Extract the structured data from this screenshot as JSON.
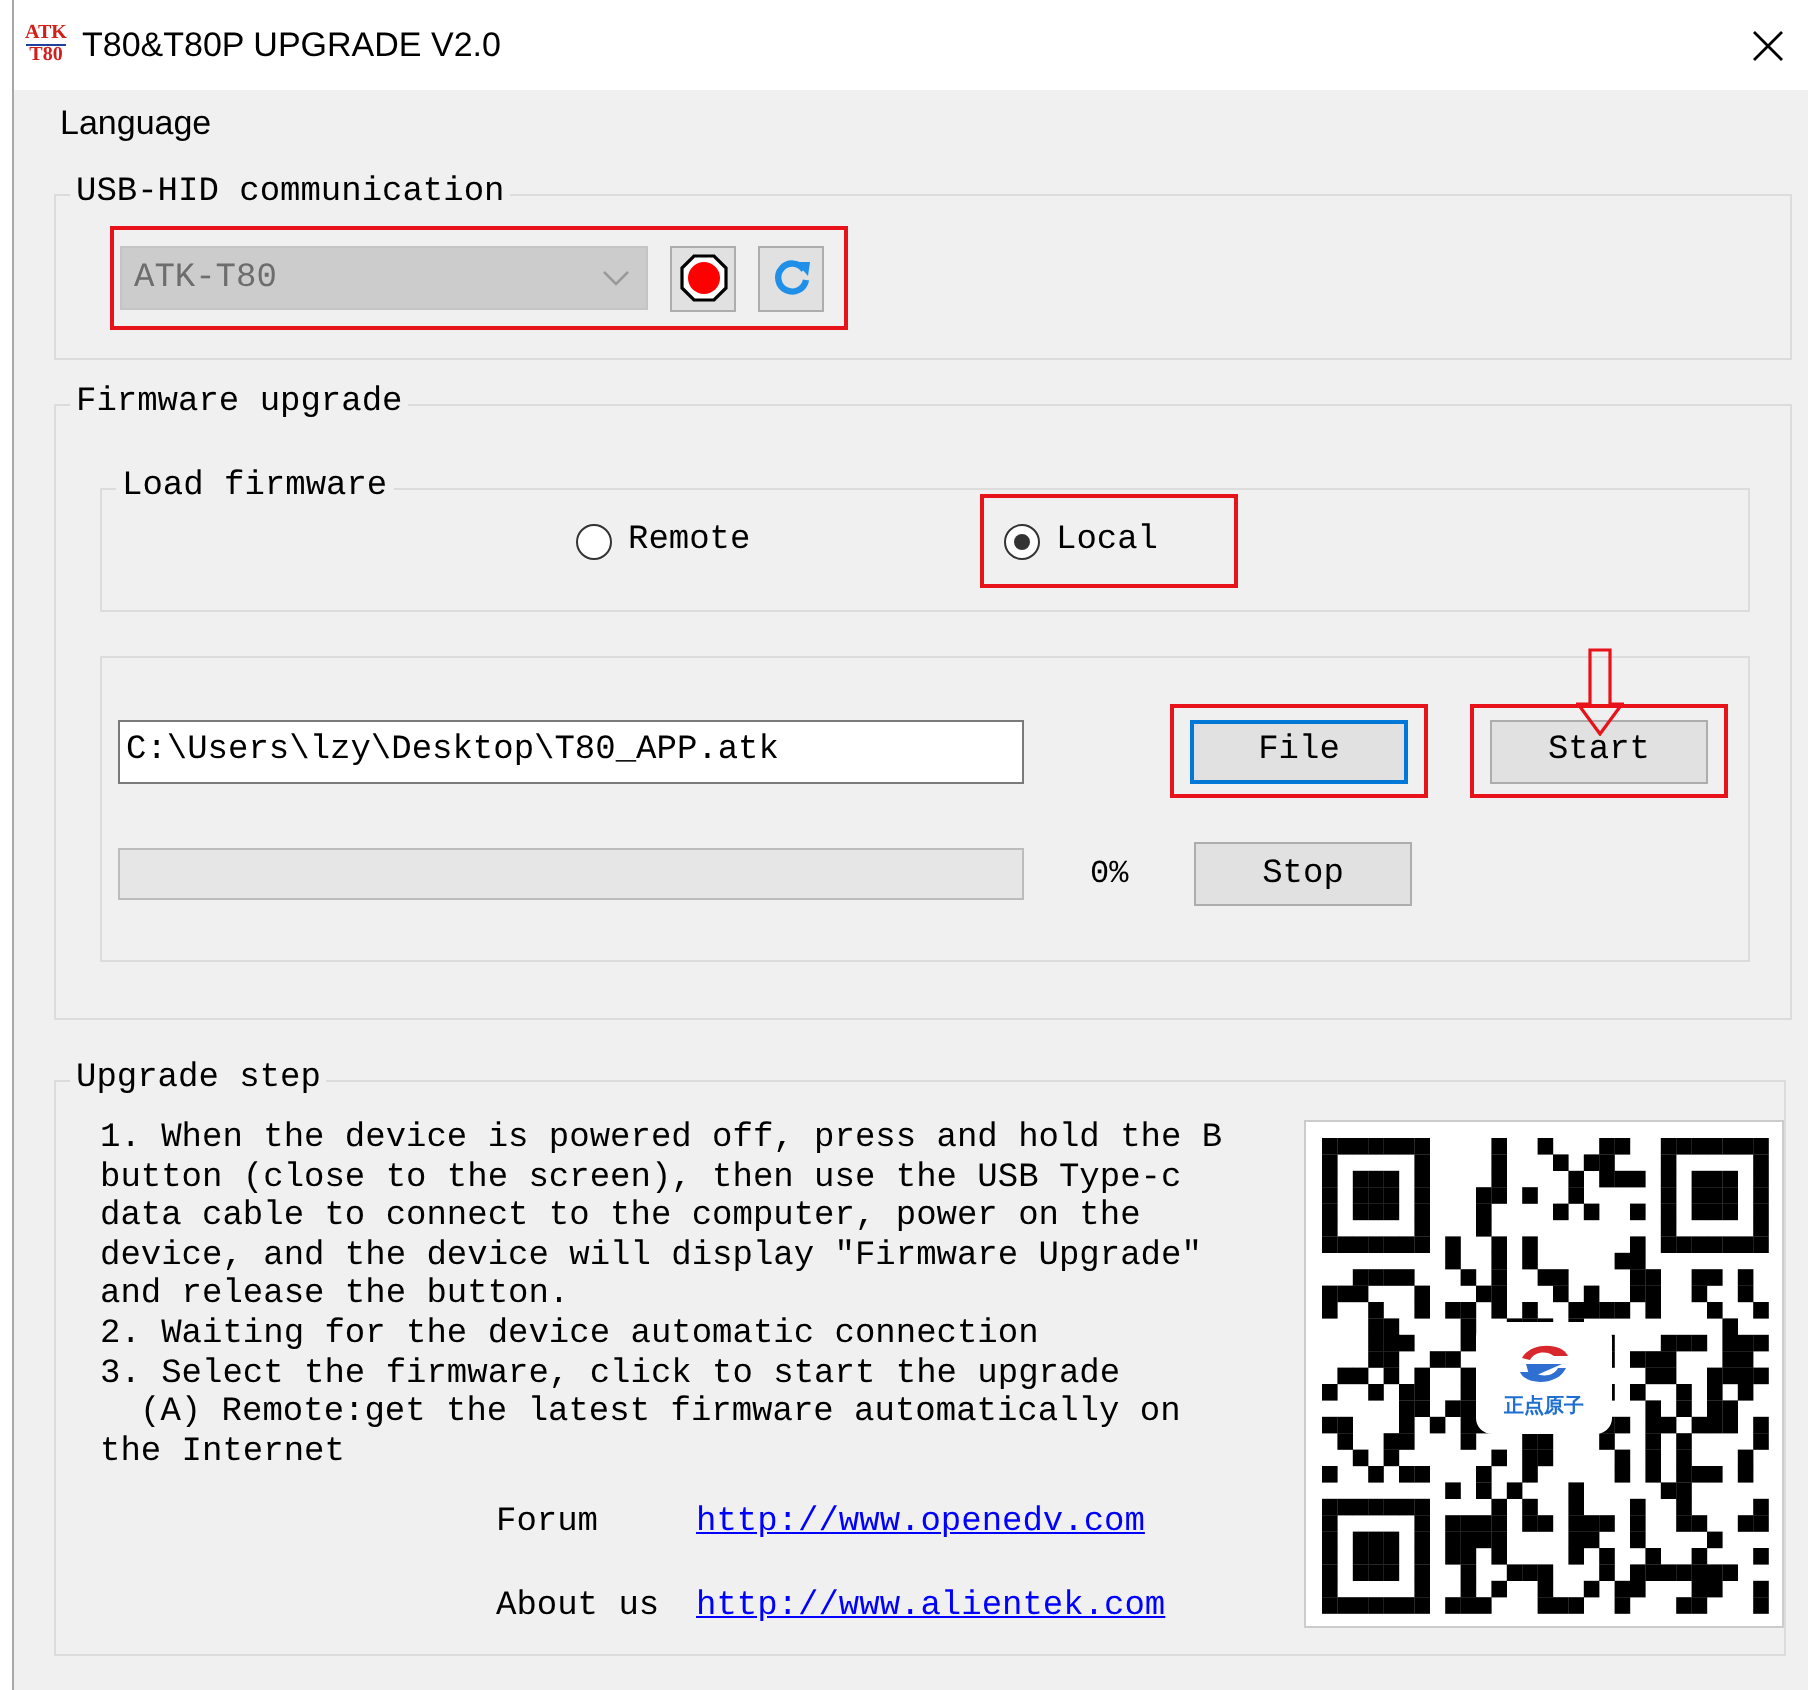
{
  "window": {
    "icon_top": "ATK",
    "icon_bottom": "T80",
    "title": "T80&T80P UPGRADE V2.0"
  },
  "menu": [
    "Language"
  ],
  "usb_group": {
    "title": "USB-HID communication",
    "device": "ATK-T80",
    "disabled": true,
    "highlighted": true
  },
  "firmware_group": {
    "title": "Firmware upgrade",
    "load": {
      "title": "Load firmware",
      "options": [
        {
          "label": "Remote",
          "selected": false,
          "highlighted": false
        },
        {
          "label": "Local",
          "selected": true,
          "highlighted": true
        }
      ]
    },
    "path": "C:\\Users\\lzy\\Desktop\\T80_APP.atk",
    "buttons": [
      {
        "label": "File",
        "focused": true,
        "highlighted": true,
        "arrow": false
      },
      {
        "label": "Start",
        "focused": false,
        "highlighted": true,
        "arrow": true
      }
    ],
    "progress": {
      "level": 0,
      "reading": "0%"
    },
    "stop": "Stop"
  },
  "upgrade_step": {
    "title": "Upgrade step",
    "lines": [
      {
        "text": "1. When the device is powered off, press and hold the B",
        "indent": false
      },
      {
        "text": "button (close to the screen), then use the USB Type-c",
        "indent": false
      },
      {
        "text": "data cable to connect to the computer, power on the",
        "indent": false
      },
      {
        "text": "device, and the device will display \"Firmware Upgrade\"",
        "indent": false
      },
      {
        "text": "and release the button.",
        "indent": false
      },
      {
        "text": "2. Waiting for the device automatic connection",
        "indent": false
      },
      {
        "text": "3. Select the firmware, click to start the upgrade",
        "indent": false
      },
      {
        "text": "(A) Remote:get the latest firmware automatically on",
        "indent": true
      },
      {
        "text": "the Internet",
        "indent": false
      }
    ],
    "links": [
      {
        "label": "Forum",
        "url": "http://www.openedv.com"
      },
      {
        "label": "About us",
        "url": "http://www.alientek.com"
      }
    ],
    "qr_logo_text": "正点原子"
  }
}
